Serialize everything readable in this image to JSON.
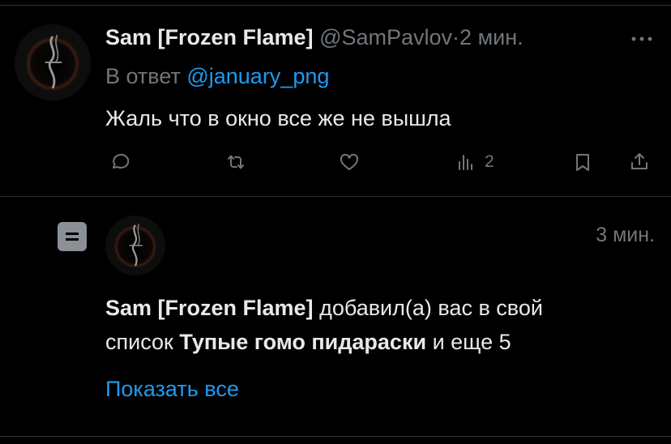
{
  "tweet": {
    "author_name": "Sam [Frozen Flame]",
    "handle": "@SamPavlov",
    "separator": "·",
    "time": "2 мин.",
    "reply_prefix": "В ответ",
    "reply_to": "@january_png",
    "text": "Жаль что в окно все же не вышла",
    "views_count": "2",
    "more_icon": "more-dots-icon",
    "actions": [
      "reply-icon",
      "retweet-icon",
      "like-icon",
      "views-icon",
      "bookmark-icon",
      "share-icon"
    ]
  },
  "notification": {
    "type_icon": "list-icon",
    "time": "3 мин.",
    "actor": "Sam [Frozen Flame]",
    "text_middle": "добавил(а) вас в свой",
    "text_list_prefix": "список",
    "list_name": "Тупые гомо пидараски",
    "text_suffix": "и еще 5",
    "show_all": "Показать все"
  },
  "colors": {
    "background": "#000000",
    "text": "#e7e9ea",
    "muted": "#71767b",
    "link": "#1d9bf0",
    "divider": "#2f3336"
  }
}
